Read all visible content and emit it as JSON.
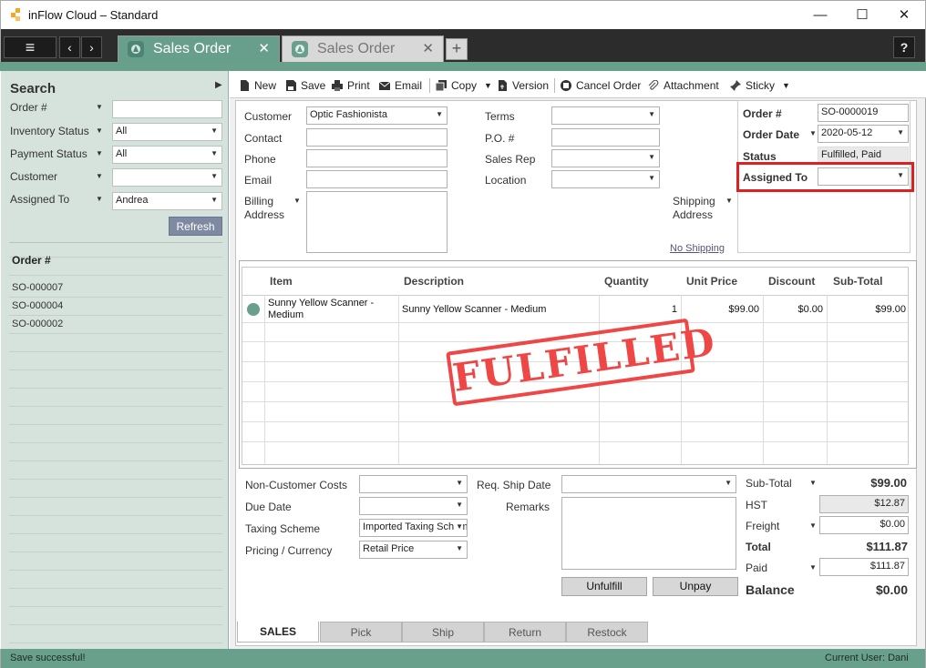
{
  "window": {
    "title": "inFlow Cloud – Standard",
    "minimize": "—",
    "maximize": "☐",
    "close": "✕"
  },
  "tabs": {
    "menu_icon": "≡",
    "back": "‹",
    "forward": "›",
    "items": [
      {
        "label": "Sales Order",
        "active": true
      },
      {
        "label": "Sales Order",
        "active": false
      }
    ],
    "close_glyph": "✕",
    "add": "+",
    "help": "?"
  },
  "search": {
    "title": "Search",
    "collapse": "▶",
    "filters": [
      {
        "label": "Order #",
        "value": ""
      },
      {
        "label": "Inventory Status",
        "value": "All"
      },
      {
        "label": "Payment Status",
        "value": "All"
      },
      {
        "label": "Customer",
        "value": ""
      },
      {
        "label": "Assigned To",
        "value": "Andrea"
      }
    ],
    "refresh": "Refresh",
    "list_header": "Order #",
    "orders": [
      "SO-000007",
      "SO-000004",
      "SO-000002"
    ]
  },
  "toolbar": {
    "new": "New",
    "save": "Save",
    "print": "Print",
    "email": "Email",
    "copy": "Copy",
    "version": "Version",
    "cancel_order": "Cancel Order",
    "attachment": "Attachment",
    "sticky": "Sticky",
    "dropdown_glyph": "▼"
  },
  "customer_section": {
    "customer_label": "Customer",
    "customer_value": "Optic Fashionista",
    "contact_label": "Contact",
    "contact_value": "",
    "phone_label": "Phone",
    "phone_value": "",
    "email_label": "Email",
    "email_value": "",
    "billing_label_1": "Billing",
    "billing_label_2": "Address",
    "billing_value": ""
  },
  "terms_section": {
    "terms_label": "Terms",
    "po_label": "P.O. #",
    "salesrep_label": "Sales Rep",
    "location_label": "Location",
    "shipping_label_1": "Shipping",
    "shipping_label_2": "Address",
    "no_shipping": "No Shipping"
  },
  "order_info": {
    "order_no_label": "Order #",
    "order_no": "SO-0000019",
    "order_date_label": "Order Date",
    "order_date": "2020-05-12",
    "status_label": "Status",
    "status": "Fulfilled, Paid",
    "assigned_label": "Assigned To",
    "assigned_value": ""
  },
  "grid": {
    "headers": [
      "Item",
      "Description",
      "Quantity",
      "Unit Price",
      "Discount",
      "Sub-Total"
    ],
    "rows": [
      {
        "item_line1": "Sunny Yellow Scanner -",
        "item_line2": "Medium",
        "description": "Sunny Yellow Scanner - Medium",
        "quantity": "1",
        "unit_price": "$99.00",
        "discount": "$0.00",
        "subtotal": "$99.00"
      }
    ]
  },
  "stamp": "FULFILLED",
  "bottom": {
    "non_customer_costs": "Non-Customer Costs",
    "due_date": "Due Date",
    "taxing_scheme": "Taxing Scheme",
    "taxing_value": "Imported Taxing Scheme",
    "pricing_currency": "Pricing / Currency",
    "pricing_value": "Retail Price",
    "req_ship_date": "Req. Ship Date",
    "remarks": "Remarks",
    "unfulfill": "Unfulfill",
    "unpay": "Unpay"
  },
  "totals": {
    "subtotal_label": "Sub-Total",
    "subtotal": "$99.00",
    "hst_label": "HST",
    "hst": "$12.87",
    "freight_label": "Freight",
    "freight": "$0.00",
    "total_label": "Total",
    "total": "$111.87",
    "paid_label": "Paid",
    "paid": "$111.87",
    "balance_label": "Balance",
    "balance": "$0.00"
  },
  "bottom_tabs": [
    "SALES",
    "Pick",
    "Ship",
    "Return",
    "Restock"
  ],
  "status": {
    "message": "Save successful!",
    "user": "Current User:  Dani"
  },
  "colors": {
    "accent": "#68a08c",
    "stamp": "#e33333",
    "highlight": "#e02020"
  }
}
